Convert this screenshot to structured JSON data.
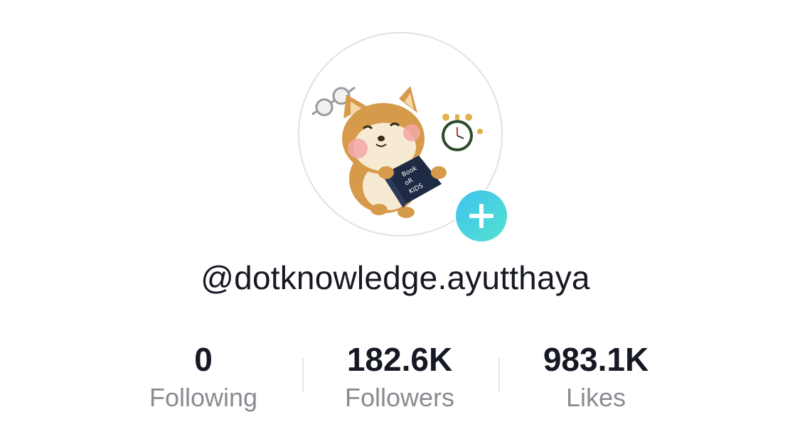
{
  "profile": {
    "username": "@dotknowledge.ayutthaya",
    "avatar_icon": "shiba-reading-book-avatar",
    "avatar_book_text": "Book FOR KIDS",
    "add_icon": "plus-icon",
    "add_gradient": [
      "#3fc3ef",
      "#53e1cf"
    ]
  },
  "stats": [
    {
      "value": "0",
      "label": "Following"
    },
    {
      "value": "182.6K",
      "label": "Followers"
    },
    {
      "value": "983.1K",
      "label": "Likes"
    }
  ],
  "colors": {
    "text_primary": "#161823",
    "text_secondary": "#8a8b91",
    "border": "#e2e2e2"
  }
}
